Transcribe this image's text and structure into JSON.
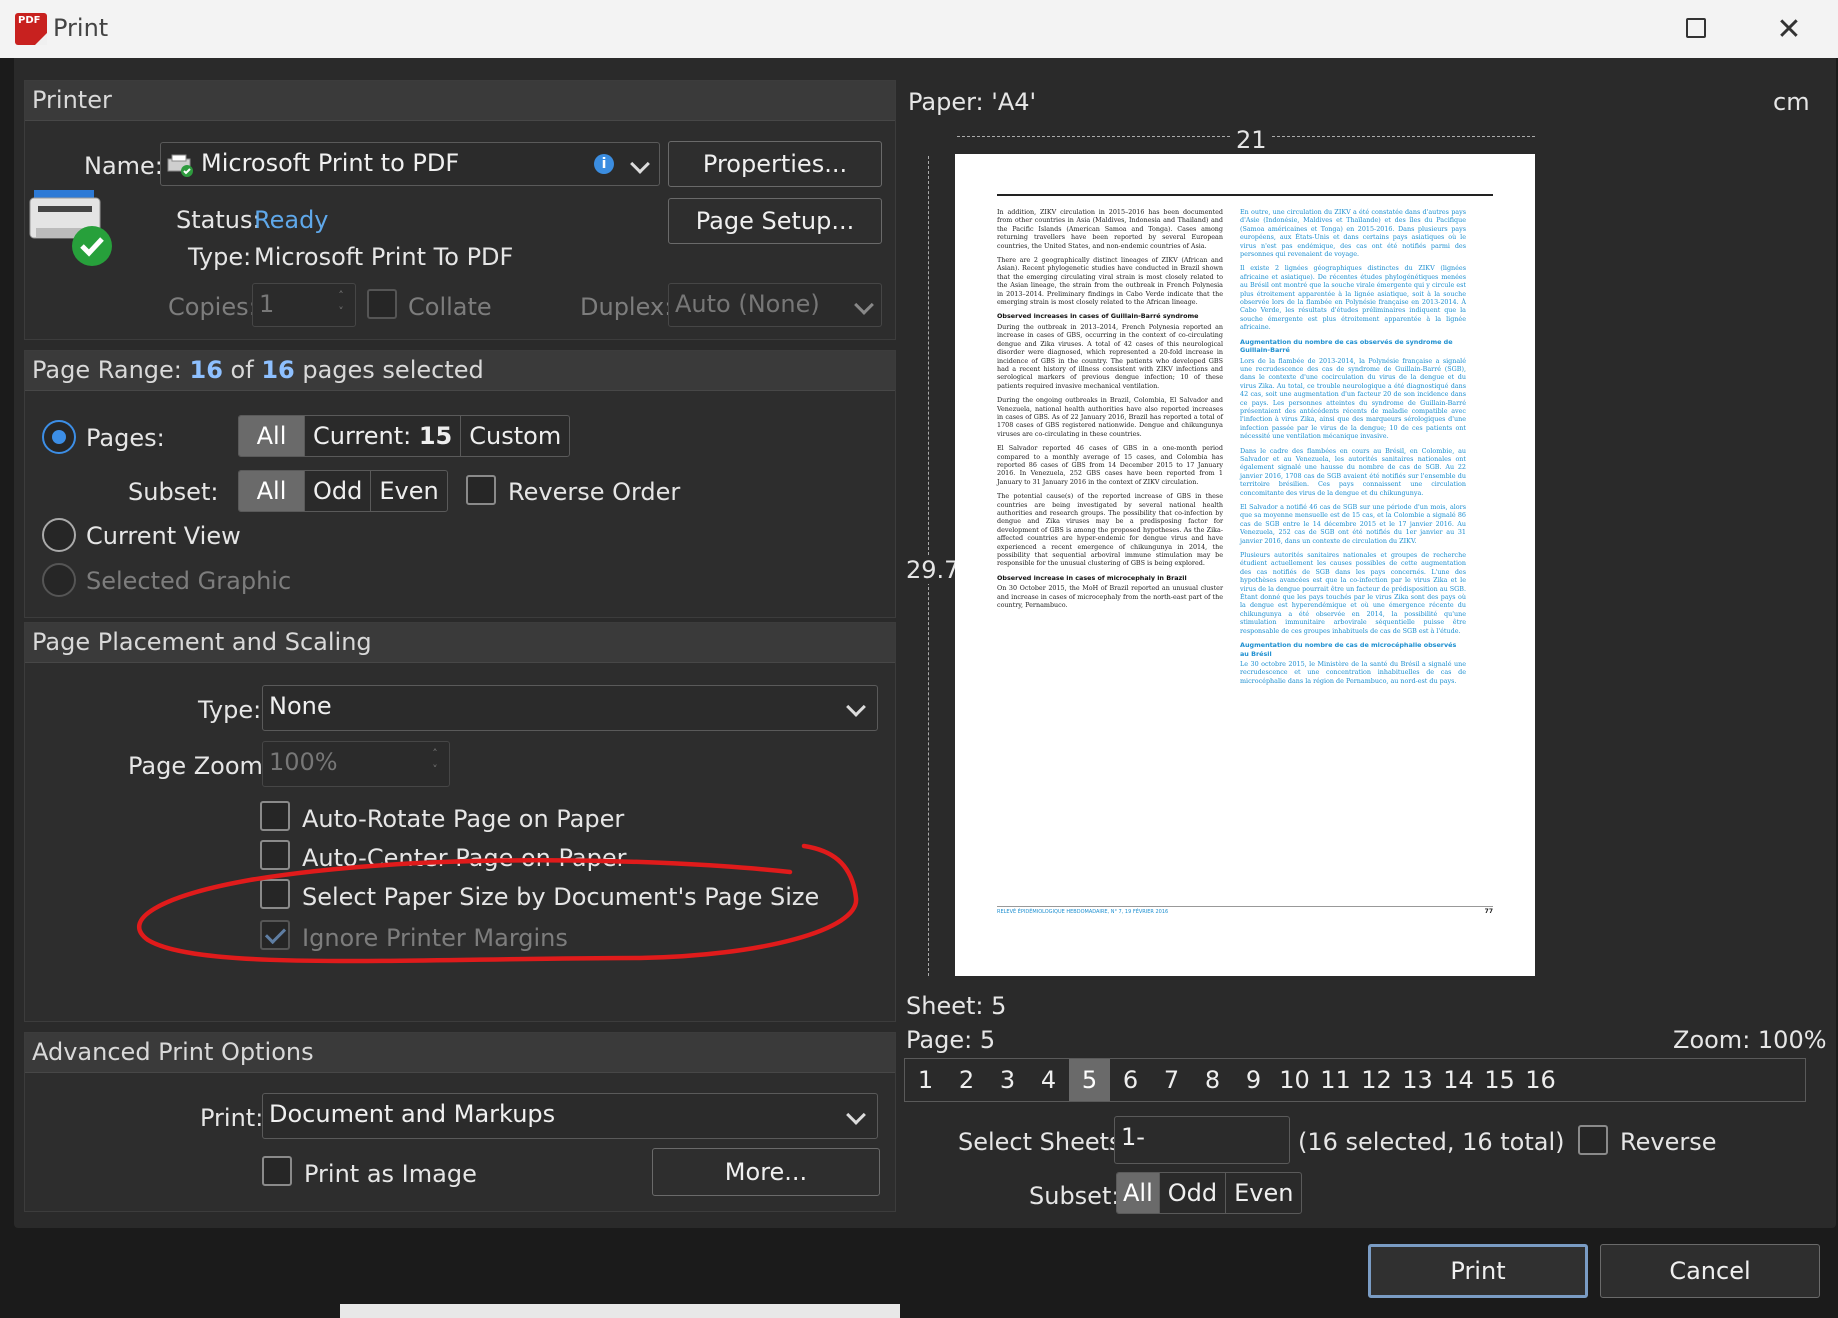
{
  "window": {
    "app_icon_text": "PDF",
    "title": "Print",
    "maximize_icon": "maximize-icon",
    "close_glyph": "✕"
  },
  "printer": {
    "header": "Printer",
    "name_label": "Name:",
    "name_value": "Microsoft Print to PDF",
    "info_glyph": "i",
    "properties_button": "Properties...",
    "page_setup_button": "Page Setup...",
    "status_label": "Status:",
    "status_value": "Ready",
    "type_label": "Type:",
    "type_value": "Microsoft Print To PDF",
    "copies_label": "Copies:",
    "copies_value": "1",
    "collate_label": "Collate",
    "duplex_label": "Duplex:",
    "duplex_value": "Auto (None)"
  },
  "page_range": {
    "header_prefix": "Page Range: ",
    "selected": "16",
    "of": " of ",
    "total": "16",
    "header_suffix": " pages selected",
    "pages_label": "Pages:",
    "modes": {
      "all": "All",
      "current_prefix": "Current: ",
      "current_num": "15",
      "custom": "Custom"
    },
    "subset_label": "Subset:",
    "subset": {
      "all": "All",
      "odd": "Odd",
      "even": "Even"
    },
    "reverse_label": "Reverse Order",
    "current_view_label": "Current View",
    "selected_graphic_label": "Selected Graphic"
  },
  "placement": {
    "header": "Page Placement and Scaling",
    "type_label": "Type:",
    "type_value": "None",
    "zoom_label": "Page Zoom:",
    "zoom_value": "100%",
    "auto_rotate": "Auto-Rotate Page on Paper",
    "auto_center": "Auto-Center Page on Paper",
    "select_paper": "Select Paper Size by Document's Page Size",
    "ignore_margins": "Ignore Printer Margins"
  },
  "advanced": {
    "header": "Advanced Print Options",
    "print_label": "Print:",
    "print_value": "Document and Markups",
    "print_as_image": "Print as Image",
    "more_button": "More..."
  },
  "preview": {
    "paper_label": "Paper: 'A4'",
    "unit": "cm",
    "width": "21",
    "height": "29.7",
    "sheet": "Sheet: 5",
    "page": "Page: 5",
    "zoom": "Zoom: 100%",
    "pages": [
      "1",
      "2",
      "3",
      "4",
      "5",
      "6",
      "7",
      "8",
      "9",
      "10",
      "11",
      "12",
      "13",
      "14",
      "15",
      "16"
    ],
    "selected_page_index": 4,
    "select_sheets_label": "Select Sheets:",
    "select_sheets_value": "1-",
    "select_sheets_info": "(16 selected, 16 total)",
    "reverse_label": "Reverse",
    "subset_label": "Subset:",
    "subset": {
      "all": "All",
      "odd": "Odd",
      "even": "Even"
    }
  },
  "doc": {
    "en": [
      "In addition, ZIKV circulation in 2015–2016 has been documented from other countries in Asia (Maldives, Indonesia and Thailand) and the Pacific Islands (American Samoa and Tonga). Cases among returning travellers have been reported by several European countries, the United States, and non-endemic countries of Asia.",
      "There are 2 geographically distinct lineages of ZIKV (African and Asian). Recent phylogenetic studies have conducted in Brazil shown that the emerging circulating viral strain is most closely related to the Asian lineage, the strain from the outbreak in French Polynesia in 2013–2014. Preliminary findings in Cabo Verde indicate that the emerging strain is most closely related to the African lineage.",
      "Observed increases in cases of Guillain-Barré syndrome",
      "During the outbreak in 2013–2014, French Polynesia reported an increase in cases of GBS, occurring in the context of co-circulating dengue and Zika viruses. A total of 42 cases of this neurological disorder were diagnosed, which represented a 20-fold increase in incidence of GBS in the country. The patients who developed GBS had a recent history of illness consistent with ZIKV infections and serological markers of previous dengue infection; 10 of these patients required invasive mechanical ventilation.",
      "During the ongoing outbreaks in Brazil, Colombia, El Salvador and Venezuela, national health authorities have also reported increases in cases of GBS. As of 22 January 2016, Brazil has reported a total of 1708 cases of GBS registered nationwide. Dengue and chikungunya viruses are co-circulating in these countries.",
      "El Salvador reported 46 cases of GBS in a one-month period compared to a monthly average of 15 cases, and Colombia has reported 86 cases of GBS from 14 December 2015 to 17 January 2016. In Venezuela, 252 GBS cases have been reported from 1 January to 31 January 2016 in the context of ZIKV circulation.",
      "The potential cause(s) of the reported increase of GBS in these countries are being investigated by several national health authorities and research groups. The possibility that co-infection by dengue and Zika viruses may be a predisposing factor for development of GBS is among the proposed hypotheses. As the Zika-affected countries are hyper-endemic for dengue virus and have experienced a recent emergence of chikungunya in 2014, the possibility that sequential arboviral immune stimulation may be responsible for the unusual clustering of GBS is being explored.",
      "Observed increase in cases of microcephaly in Brazil",
      "On 30 October 2015, the MoH of Brazil reported an unusual cluster and increase in cases of microcephaly from the north-east part of the country, Pernambuco."
    ],
    "fr": [
      "En outre, une circulation du ZIKV a été constatée dans d'autres pays d'Asie (Indonésie, Maldives et Thaïlande) et des îles du Pacifique (Samoa américaines et Tonga) en 2015-2016. Dans plusieurs pays européens, aux États-Unis et dans certains pays asiatiques où le virus n'est pas endémique, des cas ont été notifiés parmi des personnes qui revenaient de voyage.",
      "Il existe 2 lignées géographiques distinctes du ZIKV (lignées africaine et asiatique). De récentes études phylogénétiques menées au Brésil ont montré que la souche virale émergente qui y circule est plus étroitement apparentée à la lignée asiatique, soit à la souche observée lors de la flambée en Polynésie française en 2013-2014. À Cabo Verde, les résultats d'études préliminaires indiquent que la souche émergente est plus étroitement apparentée à la lignée africaine.",
      "Augmentation du nombre de cas observés de syndrome de Guillain-Barré",
      "Lors de la flambée de 2013-2014, la Polynésie française a signalé une recrudescence des cas de syndrome de Guillain-Barré (SGB), dans le contexte d'une cocirculation du virus de la dengue et du virus Zika. Au total, ce trouble neurologique a été diagnostiqué dans 42 cas, soit une augmentation d'un facteur 20 de son incidence dans ce pays. Les personnes atteintes du syndrome de Guillain-Barré présentaient des antécédents récents de maladie compatible avec l'infection à virus Zika, ainsi que des marqueurs sérologiques d'une infection passée par le virus de la dengue; 10 de ces patients ont nécessité une ventilation mécanique invasive.",
      "Dans le cadre des flambées en cours au Brésil, en Colombie, au Salvador et au Venezuela, les autorités sanitaires nationales ont également signalé une hausse du nombre de cas de SGB. Au 22 janvier 2016, 1708 cas de SGB avaient été notifiés sur l'ensemble du territoire brésilien. Ces pays connaissent une circulation concomitante des virus de la dengue et du chikungunya.",
      "El Salvador a notifié 46 cas de SGB sur une période d'un mois, alors que sa moyenne mensuelle est de 15 cas, et la Colombie a signalé 86 cas de SGB entre le 14 décembre 2015 et le 17 janvier 2016. Au Venezuela, 252 cas de SGB ont été notifiés du 1er janvier au 31 janvier 2016, dans un contexte de circulation du ZIKV.",
      "Plusieurs autorités sanitaires nationales et groupes de recherche étudient actuellement les causes possibles de cette augmentation des cas notifiés de SGB dans les pays concernés. L'une des hypothèses avancées est que la co-infection par le virus Zika et le virus de la dengue pourrait être un facteur de prédisposition au SGB. Étant donné que les pays touchés par le virus Zika sont des pays où la dengue est hyperendémique et où une émergence récente du chikungunya a été observée en 2014, la possibilité qu'une stimulation immunitaire arbovirale séquentielle puisse être responsable de ces groupes inhabituels de cas de SGB est à l'étude.",
      "Augmentation du nombre de cas de microcéphalie observés au Brésil",
      "Le 30 octobre 2015, le Ministère de la santé du Brésil a signalé une recrudescence et une concentration inhabituelles de cas de microcéphalie dans la région de Pernambuco, au nord-est du pays."
    ],
    "footer": "RELEVÉ ÉPIDÉMIOLOGIQUE HEBDOMADAIRE, N° 7, 19 FÉVRIER 2016",
    "page_number": "77"
  },
  "footer": {
    "print_button": "Print",
    "cancel_button": "Cancel"
  },
  "colors": {
    "accent": "#3c8ee6",
    "status_ready": "#5fa8ea",
    "annotation": "#e01b1b",
    "french_text": "#1d8fd0"
  }
}
